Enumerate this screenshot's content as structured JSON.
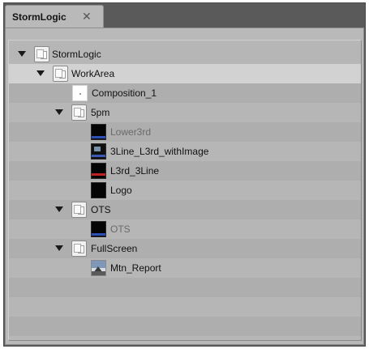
{
  "tab": {
    "title": "StormLogic",
    "close_glyph": "✕"
  },
  "tree": {
    "items": [
      {
        "label": "StormLogic",
        "icon": "folder-icon",
        "expanded": true
      },
      {
        "label": "WorkArea",
        "icon": "folder-icon",
        "expanded": true,
        "selected": true
      },
      {
        "label": "Composition_1",
        "icon": "blank-page-icon"
      },
      {
        "label": "5pm",
        "icon": "folder-icon",
        "expanded": true
      },
      {
        "label": "Lower3rd",
        "icon": "lower-third-thumbnail-icon",
        "dimmed": true
      },
      {
        "label": "3Line_L3rd_withImage",
        "icon": "image-thumbnail-icon"
      },
      {
        "label": "L3rd_3Line",
        "icon": "lower-third-red-thumbnail-icon"
      },
      {
        "label": "Logo",
        "icon": "black-thumbnail-icon"
      },
      {
        "label": "OTS",
        "icon": "folder-icon",
        "expanded": true
      },
      {
        "label": "OTS",
        "icon": "ots-thumbnail-icon",
        "dimmed": true
      },
      {
        "label": "FullScreen",
        "icon": "folder-icon",
        "expanded": true
      },
      {
        "label": "Mtn_Report",
        "icon": "mountain-photo-icon"
      }
    ]
  }
}
